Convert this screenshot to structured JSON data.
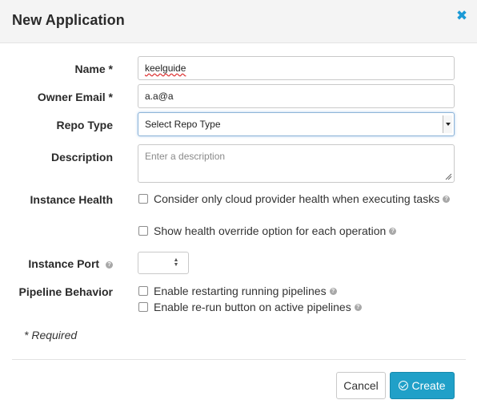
{
  "dialog": {
    "title": "New Application",
    "close_icon": "✖"
  },
  "form": {
    "name": {
      "label": "Name *",
      "value": "keelguide"
    },
    "owner_email": {
      "label": "Owner Email *",
      "value": "a.a@a"
    },
    "repo_type": {
      "label": "Repo Type",
      "selected": "Select Repo Type"
    },
    "description": {
      "label": "Description",
      "placeholder": "Enter a description"
    },
    "instance_health": {
      "label": "Instance Health",
      "options": [
        {
          "label": "Consider only cloud provider health when executing tasks",
          "checked": false
        },
        {
          "label": "Show health override option for each operation",
          "checked": false
        }
      ]
    },
    "instance_port": {
      "label": "Instance Port",
      "value": ""
    },
    "pipeline_behavior": {
      "label": "Pipeline Behavior",
      "options": [
        {
          "label": "Enable restarting running pipelines",
          "checked": false
        },
        {
          "label": "Enable re-run button on active pipelines",
          "checked": false
        }
      ]
    },
    "required_note": "* Required"
  },
  "footer": {
    "cancel_label": "Cancel",
    "create_label": "Create"
  },
  "icons": {
    "help": "?",
    "create": "circle-check"
  },
  "colors": {
    "accent": "#20a0c8",
    "close": "#1c9ad6",
    "header_bg": "#f4f4f4"
  }
}
